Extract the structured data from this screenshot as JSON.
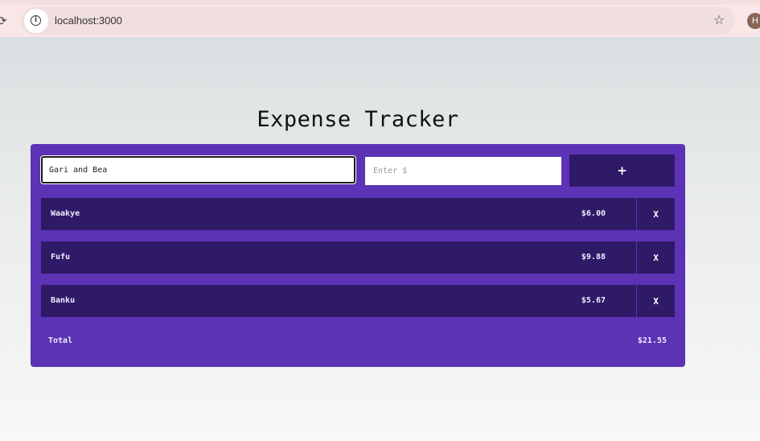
{
  "browser": {
    "url": "localhost:3000",
    "avatar_initial": "H",
    "icons": [
      "reload-icon",
      "info-icon",
      "star-icon"
    ]
  },
  "app": {
    "title": "Expense Tracker",
    "form": {
      "name_value": "Gari and Bea",
      "amount_value": "",
      "amount_placeholder": "Enter $",
      "add_label": "+"
    },
    "expenses": [
      {
        "name": "Waakye",
        "amount": "$6.00",
        "delete_label": "X"
      },
      {
        "name": "Fufu",
        "amount": "$9.88",
        "delete_label": "X"
      },
      {
        "name": "Banku",
        "amount": "$5.67",
        "delete_label": "X"
      }
    ],
    "total_label": "Total",
    "total_value": "$21.55"
  },
  "colors": {
    "card": "#5c33b5",
    "row": "#2e1a66",
    "text_light": "#f0eaff"
  }
}
